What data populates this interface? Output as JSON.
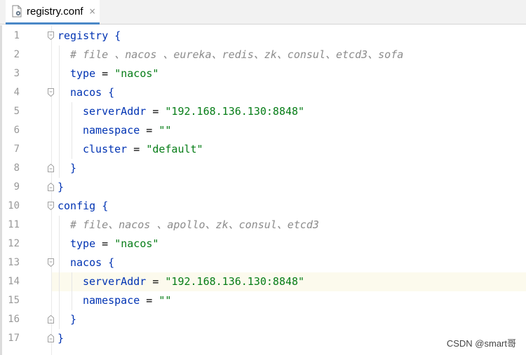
{
  "tab": {
    "label": "registry.conf",
    "close": "×",
    "icon": "config-file-icon"
  },
  "editor": {
    "current_line": 14,
    "lines": [
      {
        "n": "1",
        "indent": 0,
        "tokens": [
          {
            "t": "registry {",
            "c": "kw"
          }
        ]
      },
      {
        "n": "2",
        "indent": 1,
        "tokens": [
          {
            "t": "# file 、nacos 、eureka、redis、zk、consul、etcd3、sofa",
            "c": "cm"
          }
        ]
      },
      {
        "n": "3",
        "indent": 1,
        "tokens": [
          {
            "t": "type",
            "c": "kw"
          },
          {
            "t": " = ",
            "c": ""
          },
          {
            "t": "\"nacos\"",
            "c": "str"
          }
        ]
      },
      {
        "n": "4",
        "indent": 1,
        "tokens": [
          {
            "t": "nacos {",
            "c": "kw"
          }
        ]
      },
      {
        "n": "5",
        "indent": 2,
        "tokens": [
          {
            "t": "serverAddr",
            "c": "kw"
          },
          {
            "t": " = ",
            "c": ""
          },
          {
            "t": "\"192.168.136.130:8848\"",
            "c": "str"
          }
        ]
      },
      {
        "n": "6",
        "indent": 2,
        "tokens": [
          {
            "t": "namespace",
            "c": "kw"
          },
          {
            "t": " = ",
            "c": ""
          },
          {
            "t": "\"\"",
            "c": "str"
          }
        ]
      },
      {
        "n": "7",
        "indent": 2,
        "tokens": [
          {
            "t": "cluster",
            "c": "kw"
          },
          {
            "t": " = ",
            "c": ""
          },
          {
            "t": "\"default\"",
            "c": "str"
          }
        ]
      },
      {
        "n": "8",
        "indent": 1,
        "tokens": [
          {
            "t": "}",
            "c": "kw"
          }
        ]
      },
      {
        "n": "9",
        "indent": 0,
        "tokens": [
          {
            "t": "}",
            "c": "kw"
          }
        ]
      },
      {
        "n": "10",
        "indent": 0,
        "tokens": [
          {
            "t": "config {",
            "c": "kw"
          }
        ]
      },
      {
        "n": "11",
        "indent": 1,
        "tokens": [
          {
            "t": "# file、nacos 、apollo、zk、consul、etcd3",
            "c": "cm"
          }
        ]
      },
      {
        "n": "12",
        "indent": 1,
        "tokens": [
          {
            "t": "type",
            "c": "kw"
          },
          {
            "t": " = ",
            "c": ""
          },
          {
            "t": "\"nacos\"",
            "c": "str"
          }
        ]
      },
      {
        "n": "13",
        "indent": 1,
        "tokens": [
          {
            "t": "nacos {",
            "c": "kw"
          }
        ]
      },
      {
        "n": "14",
        "indent": 2,
        "tokens": [
          {
            "t": "serverAddr",
            "c": "kw"
          },
          {
            "t": " = ",
            "c": ""
          },
          {
            "t": "\"192.168.136.130:8848\"",
            "c": "str"
          }
        ]
      },
      {
        "n": "15",
        "indent": 2,
        "tokens": [
          {
            "t": "namespace",
            "c": "kw"
          },
          {
            "t": " = ",
            "c": ""
          },
          {
            "t": "\"\"",
            "c": "str"
          }
        ]
      },
      {
        "n": "16",
        "indent": 1,
        "tokens": [
          {
            "t": "}",
            "c": "kw"
          }
        ]
      },
      {
        "n": "17",
        "indent": 0,
        "tokens": [
          {
            "t": "}",
            "c": "kw"
          }
        ]
      }
    ],
    "fold_open": [
      "1",
      "4",
      "10",
      "13"
    ],
    "fold_close": [
      "8",
      "9",
      "16",
      "17"
    ]
  },
  "watermark": "CSDN @smart哥",
  "colors": {
    "keyword": "#0033b3",
    "string": "#067d17",
    "comment": "#8c8c8c",
    "current_line": "#fcfaed",
    "tab_underline": "#4a88c7"
  }
}
